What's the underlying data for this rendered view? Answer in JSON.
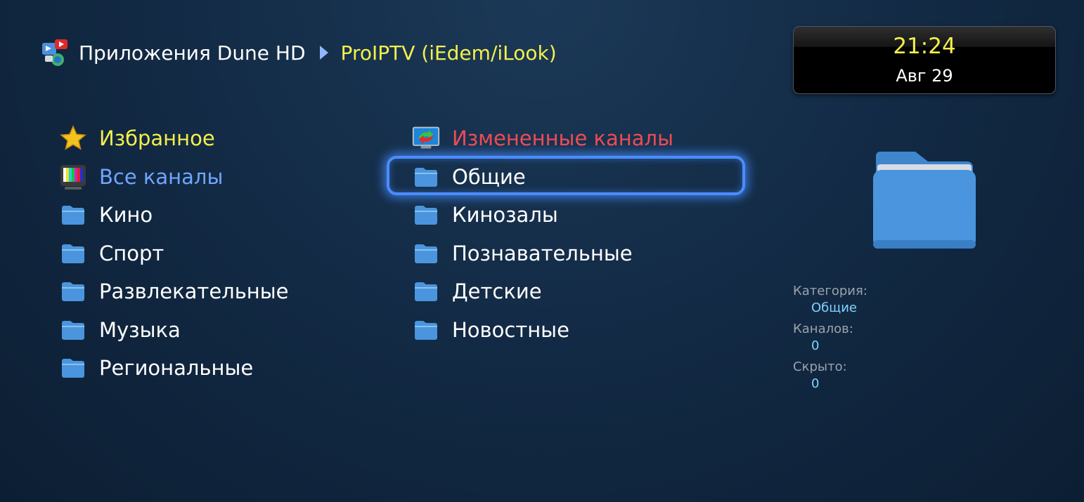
{
  "breadcrumb": {
    "root_label": "Приложения Dune HD",
    "current_label": "ProIPTV (iEdem/iLook)"
  },
  "clock": {
    "time": "21:24",
    "date": "Авг 29"
  },
  "left_column": [
    {
      "label": "Избранное",
      "icon": "star-icon",
      "color": "#f4f04a"
    },
    {
      "label": "Все каналы",
      "icon": "tv-icon",
      "color": "#6fa6ff"
    },
    {
      "label": "Кино",
      "icon": "folder-icon",
      "color": "#ffffff"
    },
    {
      "label": "Спорт",
      "icon": "folder-icon",
      "color": "#ffffff"
    },
    {
      "label": "Развлекательные",
      "icon": "folder-icon",
      "color": "#ffffff"
    },
    {
      "label": "Музыка",
      "icon": "folder-icon",
      "color": "#ffffff"
    },
    {
      "label": "Региональные",
      "icon": "folder-icon",
      "color": "#ffffff"
    }
  ],
  "right_column": [
    {
      "label": "Измененные каналы",
      "icon": "changed-channels-icon",
      "color": "#ef4b55"
    },
    {
      "label": "Общие",
      "icon": "folder-icon",
      "color": "#ffffff",
      "selected": true
    },
    {
      "label": "Кинозалы",
      "icon": "folder-icon",
      "color": "#ffffff"
    },
    {
      "label": "Познавательные",
      "icon": "folder-icon",
      "color": "#ffffff"
    },
    {
      "label": "Детские",
      "icon": "folder-icon",
      "color": "#ffffff"
    },
    {
      "label": "Новостные",
      "icon": "folder-icon",
      "color": "#ffffff"
    }
  ],
  "details": {
    "category_label": "Категория:",
    "category_value": "Общие",
    "channels_label": "Каналов:",
    "channels_value": "0",
    "hidden_label": "Скрыто:",
    "hidden_value": "0"
  },
  "colors": {
    "accent_yellow": "#f4f04a",
    "accent_blue": "#6fa6ff",
    "accent_red": "#ef4b55",
    "focus_blue": "#4a8dff",
    "folder_blue": "#4a95dd"
  }
}
